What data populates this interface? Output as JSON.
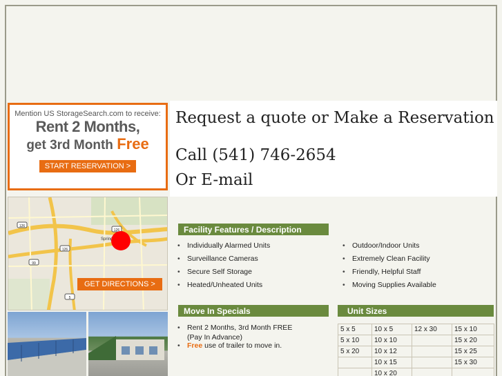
{
  "promo": {
    "mention": "Mention US StorageSearch.com to receive:",
    "line1": "Rent 2 Months,",
    "line2a": "get 3rd Month ",
    "line2b": "Free",
    "button": "START RESERVATION >"
  },
  "quote": {
    "title": "Request a quote or Make a Reservation",
    "call": "Call (541) 746-2654",
    "email": "Or E-mail"
  },
  "map": {
    "directions": "GET DIRECTIONS >",
    "route_labels": [
      "126",
      "126",
      "126",
      "99",
      "5"
    ],
    "place_label": "Spring"
  },
  "features": {
    "heading": "Facility Features / Description",
    "left": [
      "Individually Alarmed Units",
      "Surveillance Cameras",
      "Secure Self Storage",
      "Heated/Unheated Units"
    ],
    "right": [
      "Outdoor/Indoor Units",
      "Extremely Clean Facility",
      "Friendly, Helpful Staff",
      "Moving Supplies Available"
    ]
  },
  "specials": {
    "heading": "Move In Specials",
    "item1_line1": "Rent 2 Months, 3rd Month FREE",
    "item1_line2": "(Pay In Advance)",
    "item2_free": "Free",
    "item2_rest": " use of trailer to move in."
  },
  "units": {
    "heading": "Unit Sizes",
    "rows": [
      [
        "5 x 5",
        "10 x 5",
        "12 x 30",
        "15 x 10"
      ],
      [
        "5 x 10",
        "10 x 10",
        "",
        "15 x 20"
      ],
      [
        "5 x 20",
        "10 x 12",
        "",
        "15 x 25"
      ],
      [
        "",
        "10 x 15",
        "",
        "15 x 30"
      ],
      [
        "",
        "10 x 20",
        "",
        ""
      ]
    ]
  },
  "colors": {
    "accent_orange": "#e86c12",
    "section_green": "#6a8a3e",
    "page_bg": "#f4f4ee"
  }
}
